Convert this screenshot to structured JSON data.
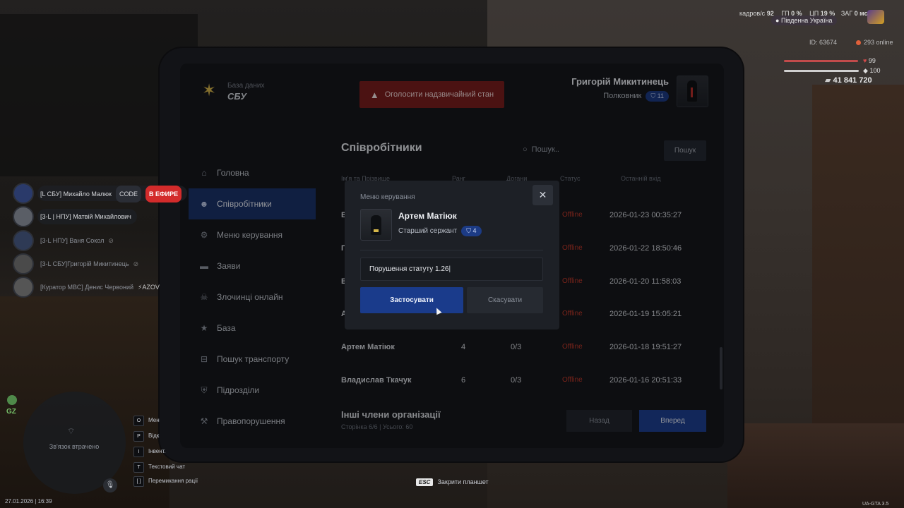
{
  "hud": {
    "fps_label": "кадров/с",
    "fps_value": "92",
    "gpu_label": "ГП",
    "gpu_value": "0 %",
    "cpu_label": "ЦП",
    "cpu_value": "19 %",
    "lat_label": "ЗАГ",
    "lat_value": "0 мс",
    "region": "Південна Україна",
    "player_id": "ID: 63674",
    "online": "293 online",
    "health": "99",
    "armor": "100",
    "money": "41 841 720",
    "health_fraction": 0.99,
    "armor_fraction": 1.0
  },
  "tablet": {
    "brand_sub": "База даних",
    "brand_name": "СБУ",
    "emergency_label": "Оголосити надзвичайний стан",
    "user_name": "Григорій Микитинець",
    "user_rank": "Полковник",
    "user_rank_level": "11",
    "nav": [
      {
        "label": "Головна",
        "icon": "home-icon"
      },
      {
        "label": "Співробітники",
        "icon": "users-icon",
        "active": true
      },
      {
        "label": "Меню керування",
        "icon": "gear-icon"
      },
      {
        "label": "Заяви",
        "icon": "folder-icon"
      },
      {
        "label": "Злочинці онлайн",
        "icon": "mask-icon"
      },
      {
        "label": "База",
        "icon": "star-icon"
      },
      {
        "label": "Пошук транспорту",
        "icon": "car-icon"
      },
      {
        "label": "Підрозділи",
        "icon": "shield-icon"
      },
      {
        "label": "Правопорушення",
        "icon": "gavel-icon"
      }
    ],
    "section_title": "Співробітники",
    "search_placeholder": "Пошук..",
    "search_button": "Пошук",
    "columns": [
      "Ім'я та Прізвище",
      "Ранг",
      "Догани",
      "Статус",
      "Останній вхід"
    ],
    "rows": [
      {
        "name": "В",
        "rank": "",
        "warns": "",
        "status": "Offline",
        "last": "2026-01-23 00:35:27"
      },
      {
        "name": "П",
        "rank": "",
        "warns": "",
        "status": "Offline",
        "last": "2026-01-22 18:50:46"
      },
      {
        "name": "В",
        "rank": "",
        "warns": "",
        "status": "Offline",
        "last": "2026-01-20 11:58:03"
      },
      {
        "name": "А",
        "rank": "",
        "warns": "",
        "status": "Offline",
        "last": "2026-01-19 15:05:21"
      },
      {
        "name": "Артем Матіюк",
        "rank": "4",
        "warns": "0/3",
        "status": "Offline",
        "last": "2026-01-18 19:51:27"
      },
      {
        "name": "Владислав Ткачук",
        "rank": "6",
        "warns": "0/3",
        "status": "Offline",
        "last": "2026-01-16 20:51:33"
      }
    ],
    "others_title": "Інші члени організації",
    "page_info": "Сторінка 6/6 | Усього: 60",
    "prev_button": "Назад",
    "next_button": "Вперед"
  },
  "modal": {
    "title": "Меню керування",
    "name": "Артем Матіюк",
    "rank": "Старший сержант",
    "rank_level": "4",
    "reason_value": "Порушення статуту 1.26",
    "apply_button": "Застосувати",
    "cancel_button": "Скасувати"
  },
  "voice": [
    {
      "name": "[L СБУ] Михайло Малюк",
      "tag_code": "CODE",
      "tag_live": "В ЕФИРЕ"
    },
    {
      "name": "[3-L | НПУ] Матвій Михайлович"
    },
    {
      "name": "[3-L НПУ] Ваня Сокол",
      "muted": true
    },
    {
      "name": "[3-L СБУ]Григорій Микитинець",
      "muted": true
    },
    {
      "name": "[Куратор МВС] Денис Червоний",
      "tag_azov": "AZOV"
    }
  ],
  "minimap": {
    "gz": "GZ",
    "lost": "Зв'язок втрачено"
  },
  "hints": [
    {
      "key": "O",
      "label": "Мен"
    },
    {
      "key": "P",
      "label": "Відк"
    },
    {
      "key": "I",
      "label": "Інвент."
    },
    {
      "key": "T",
      "label": "Текстовий чат"
    },
    {
      "key": "[ ]",
      "label": "Перемикання рації"
    }
  ],
  "esc_key": "ESC",
  "esc_label": "Закрити планшет",
  "datetime": "27.01.2026 | 16:39",
  "version": "UA-GTA 3.5"
}
